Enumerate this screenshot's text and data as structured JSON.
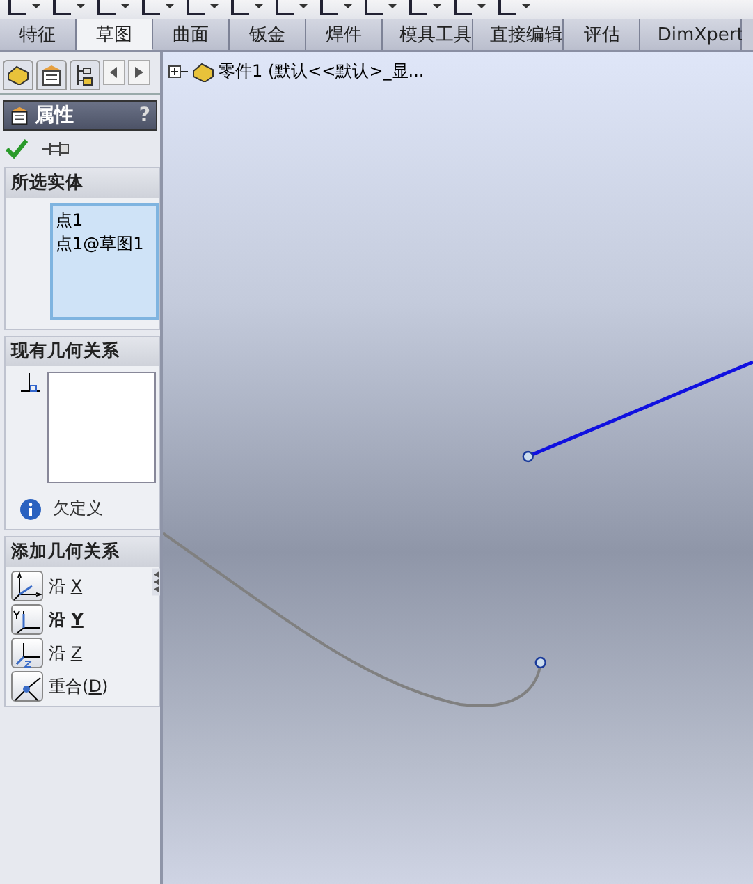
{
  "tabs": [
    {
      "label": "特征",
      "selected": false
    },
    {
      "label": "草图",
      "selected": true
    },
    {
      "label": "曲面",
      "selected": false
    },
    {
      "label": "钣金",
      "selected": false
    },
    {
      "label": "焊件",
      "selected": false
    },
    {
      "label": "模具工具",
      "selected": false
    },
    {
      "label": "直接编辑",
      "selected": false
    },
    {
      "label": "评估",
      "selected": false
    },
    {
      "label": "DimXpert",
      "selected": false
    }
  ],
  "panel": {
    "title": "属性",
    "help": "?",
    "selected_entities": {
      "title": "所选实体",
      "items": [
        "点1",
        "点1@草图1"
      ]
    },
    "existing_relations": {
      "title": "现有几何关系",
      "status": "欠定义"
    },
    "add_relations": {
      "title": "添加几何关系",
      "items": [
        {
          "kind": "horizontal",
          "label": "沿 ",
          "shortcut": "X",
          "bold": false
        },
        {
          "kind": "vertical",
          "label": "沿 ",
          "shortcut": "Y",
          "bold": true
        },
        {
          "kind": "depth",
          "label": "沿 ",
          "shortcut": "Z",
          "bold": false
        },
        {
          "kind": "coincident",
          "label": "重合(",
          "shortcut": "D",
          "suffix": ")",
          "bold": false
        }
      ]
    }
  },
  "tree": {
    "label": "零件1  (默认<<默认>_显..."
  }
}
